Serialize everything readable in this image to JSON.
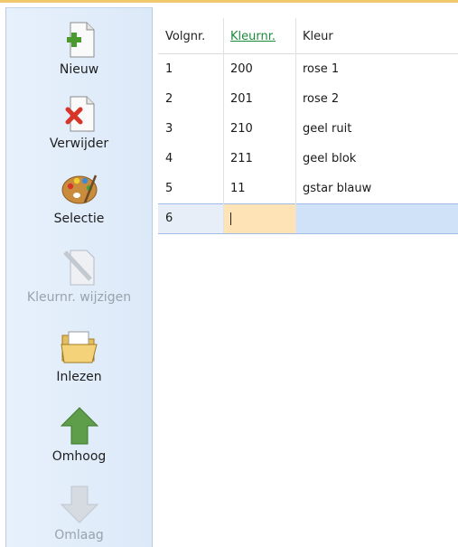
{
  "toolbar": {
    "new_label": "Nieuw",
    "delete_label": "Verwijder",
    "select_label": "Selectie",
    "change_color_label": "Kleurnr. wijzigen",
    "import_label": "Inlezen",
    "up_label": "Omhoog",
    "down_label": "Omlaag"
  },
  "grid": {
    "headers": [
      "Volgnr.",
      "Kleurnr.",
      "Kleur"
    ],
    "rows": [
      [
        "1",
        "200",
        "rose 1"
      ],
      [
        "2",
        "201",
        "rose 2"
      ],
      [
        "3",
        "210",
        "geel ruit"
      ],
      [
        "4",
        "211",
        "geel blok"
      ],
      [
        "5",
        "11",
        "gstar blauw"
      ]
    ],
    "new_row": [
      "6",
      "",
      ""
    ]
  },
  "colors": {
    "accent_header": "#1b8a3a",
    "selection": "#cfe2f7",
    "edit_cell": "#fde3b6",
    "toolbar_bg": "#e1edfa"
  }
}
